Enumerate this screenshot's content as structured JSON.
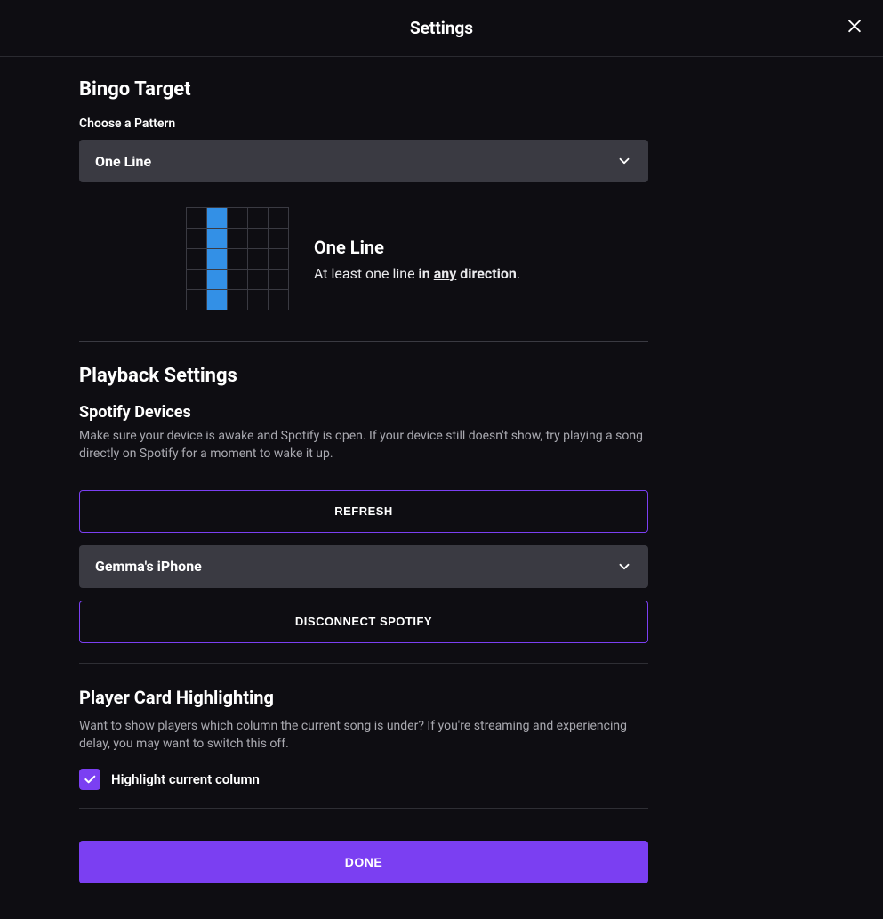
{
  "header": {
    "title": "Settings"
  },
  "bingo": {
    "title": "Bingo Target",
    "pattern_label": "Choose a Pattern",
    "pattern_value": "One Line",
    "pattern_name": "One Line",
    "pattern_desc_prefix": "At least one line ",
    "pattern_desc_bold1": "in ",
    "pattern_desc_underline": "any",
    "pattern_desc_bold2": " direction",
    "pattern_desc_suffix": ".",
    "pattern_grid": [
      [
        0,
        1,
        0,
        0,
        0
      ],
      [
        0,
        1,
        0,
        0,
        0
      ],
      [
        0,
        1,
        0,
        0,
        0
      ],
      [
        0,
        1,
        0,
        0,
        0
      ],
      [
        0,
        1,
        0,
        0,
        0
      ]
    ]
  },
  "playback": {
    "title": "Playback Settings",
    "devices_title": "Spotify Devices",
    "devices_help": "Make sure your device is awake and Spotify is open. If your device still doesn't show, try playing a song directly on Spotify for a moment to wake it up.",
    "refresh_label": "REFRESH",
    "device_value": "Gemma's iPhone",
    "disconnect_label": "DISCONNECT SPOTIFY"
  },
  "highlighting": {
    "title": "Player Card Highlighting",
    "desc": "Want to show players which column the current song is under? If you're streaming and experiencing delay, you may want to switch this off.",
    "checkbox_label": "Highlight current column",
    "checked": true
  },
  "footer": {
    "done_label": "DONE"
  }
}
